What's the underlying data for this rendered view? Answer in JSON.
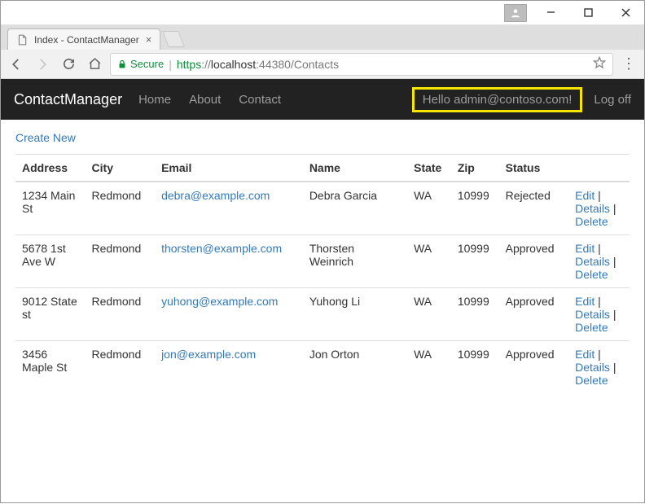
{
  "window": {
    "user_icon": "person-icon",
    "minimize": "minimize-icon",
    "maximize": "maximize-icon",
    "close": "close-icon"
  },
  "tab": {
    "title": "Index - ContactManager",
    "close_label": "×"
  },
  "address_bar": {
    "secure_label": "Secure",
    "scheme": "https",
    "sep1": "://",
    "host_strong": "localhost",
    "host_rest": ":44380/Contacts"
  },
  "navbar": {
    "brand": "ContactManager",
    "links": [
      "Home",
      "About",
      "Contact"
    ],
    "greeting": "Hello admin@contoso.com!",
    "logoff": "Log off"
  },
  "page": {
    "create_label": "Create New",
    "columns": [
      "Address",
      "City",
      "Email",
      "Name",
      "State",
      "Zip",
      "Status"
    ],
    "action_labels": {
      "edit": "Edit",
      "details": "Details",
      "delete": "Delete"
    },
    "rows": [
      {
        "address": "1234 Main St",
        "city": "Redmond",
        "email": "debra@example.com",
        "name": "Debra Garcia",
        "state": "WA",
        "zip": "10999",
        "status": "Rejected"
      },
      {
        "address": "5678 1st Ave W",
        "city": "Redmond",
        "email": "thorsten@example.com",
        "name": "Thorsten Weinrich",
        "state": "WA",
        "zip": "10999",
        "status": "Approved"
      },
      {
        "address": "9012 State st",
        "city": "Redmond",
        "email": "yuhong@example.com",
        "name": "Yuhong Li",
        "state": "WA",
        "zip": "10999",
        "status": "Approved"
      },
      {
        "address": "3456 Maple St",
        "city": "Redmond",
        "email": "jon@example.com",
        "name": "Jon Orton",
        "state": "WA",
        "zip": "10999",
        "status": "Approved"
      }
    ]
  }
}
